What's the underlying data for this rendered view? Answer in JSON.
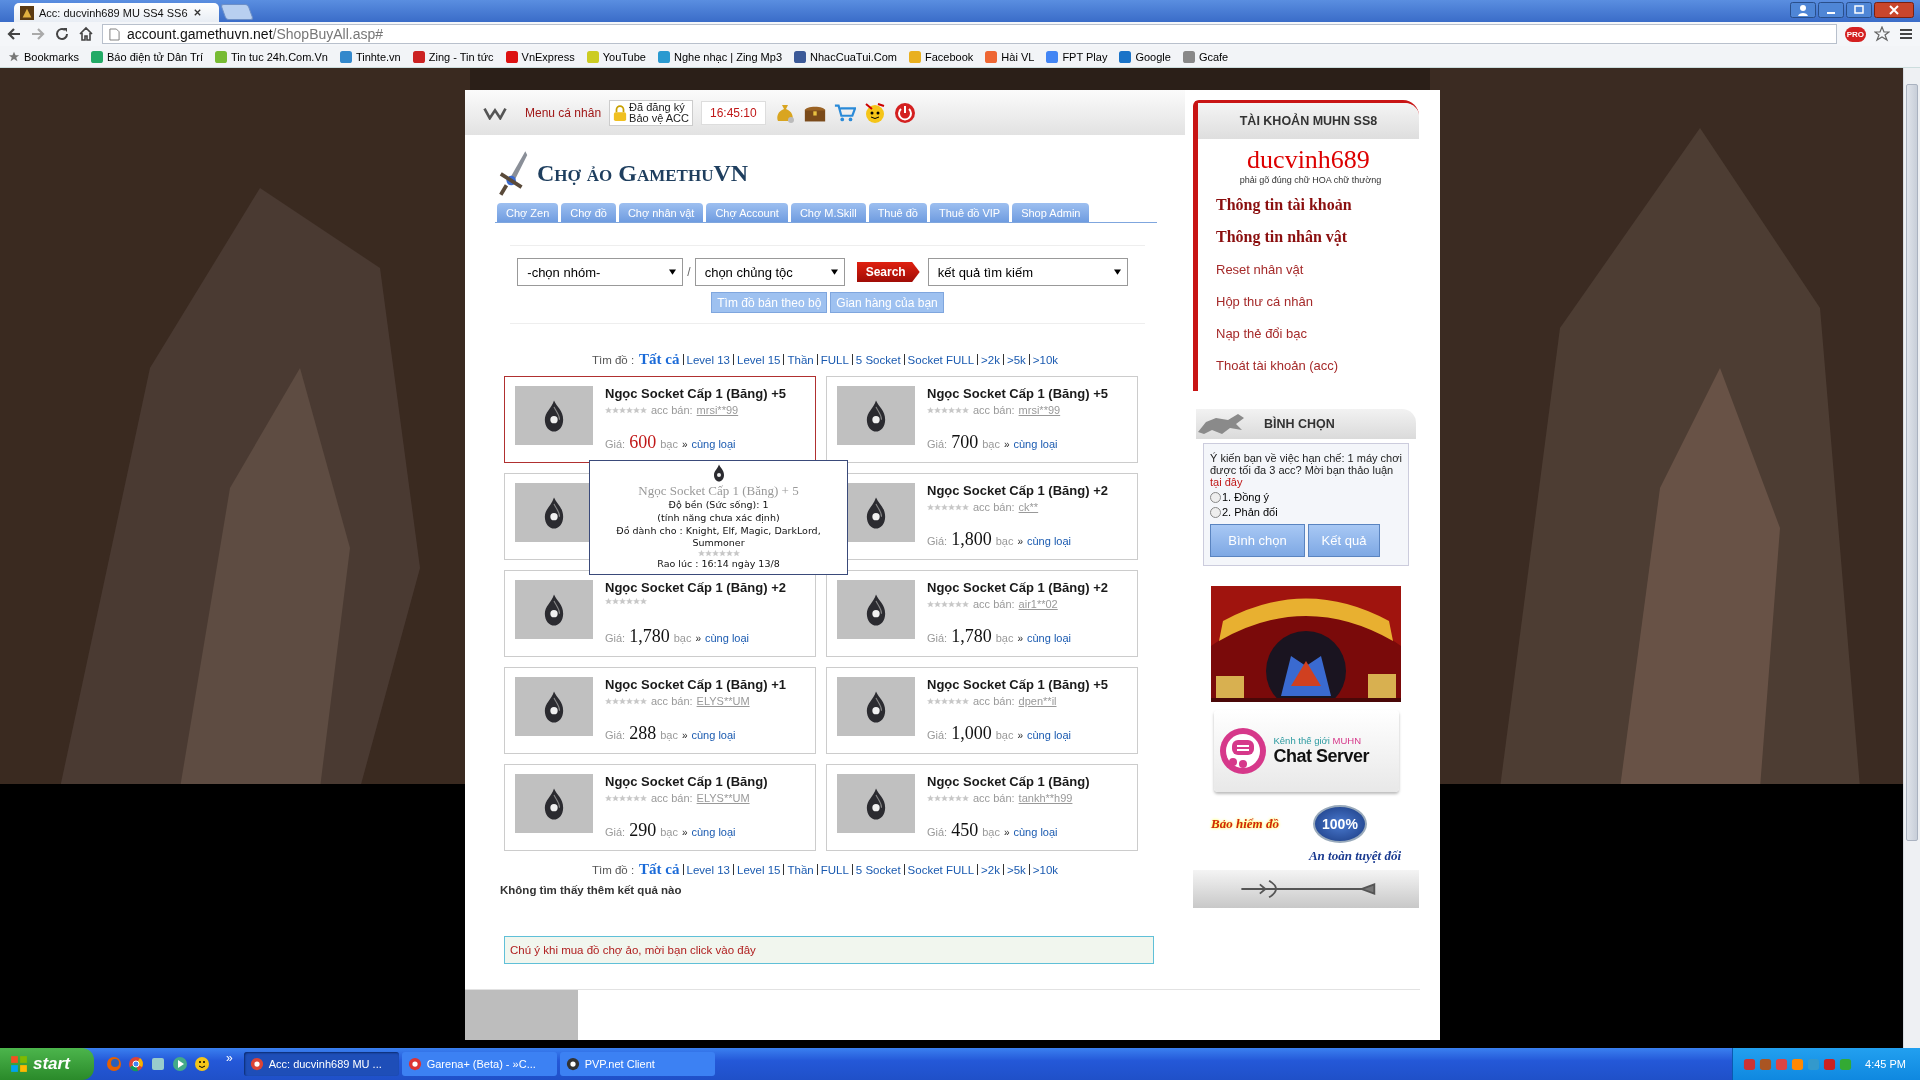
{
  "browser": {
    "tab_title": "Acc: ducvinh689 MU SS4 SS6",
    "address": {
      "host": "account.gamethuvn.net",
      "path": "/ShopBuyAll.asp#"
    },
    "extension_badge": "PRO",
    "bookmarks": [
      "Bookmarks",
      "Báo điện tử Dân Trí",
      "Tin tuc 24h.Com.Vn",
      "Tinhte.vn",
      "Zing - Tin tức",
      "VnExpress",
      "YouTube",
      "Nghe nhạc | Zing Mp3",
      "NhacCuaTui.Com",
      "Facebook",
      "Hài VL",
      "FPT Play",
      "Google",
      "Gcafe"
    ]
  },
  "topbar": {
    "menu": "Menu cá nhân",
    "protection": {
      "line1": "Đã đăng ký",
      "line2": "Bảo vệ ACC"
    },
    "clock": "16:45:10"
  },
  "title": "Chợ ảo GamethuVN",
  "tabs": [
    {
      "label": "Chợ Zen",
      "selected": false
    },
    {
      "label": "Chợ đồ",
      "selected": false
    },
    {
      "label": "Chợ nhân vật",
      "selected": false
    },
    {
      "label": "Chợ Account",
      "selected": false
    },
    {
      "label": "Chợ M.Skill",
      "selected": false
    },
    {
      "label": "Thuê đồ",
      "selected": false
    },
    {
      "label": "Thuê đồ VIP",
      "selected": false
    },
    {
      "label": "Shop Admin",
      "selected": false
    }
  ],
  "search": {
    "group": "-chọn nhóm-",
    "separator": "/",
    "race": "chọn chủng tộc",
    "button": "Search",
    "results": "kết quả tìm kiếm",
    "actions": [
      "Tìm đồ bán theo bộ",
      "Gian hàng của bạn"
    ]
  },
  "filters_top": {
    "label": "Tìm đồ :",
    "links": [
      {
        "text": "Tất cả",
        "selected": true
      },
      {
        "text": "Level 13",
        "selected": false
      },
      {
        "text": "Level 15",
        "selected": false
      },
      {
        "text": "Thần",
        "selected": false
      },
      {
        "text": "FULL",
        "selected": false
      },
      {
        "text": "5 Socket",
        "selected": false
      },
      {
        "text": "Socket FULL",
        "selected": false
      },
      {
        "text": ">2k",
        "selected": false
      },
      {
        "text": ">5k",
        "selected": false
      },
      {
        "text": ">10k",
        "selected": false
      }
    ]
  },
  "items": [
    {
      "title": "Ngọc Socket Cấp 1 (Băng) +5",
      "stars": 0,
      "seller_label": "acc bán:",
      "seller": "mrsi**99",
      "price_label": "Giá:",
      "price": "600",
      "unit": "bạc",
      "arrow": "»",
      "link": "cùng loại",
      "hovered": true
    },
    {
      "title": "Ngọc Socket Cấp 1 (Băng) +5",
      "stars": 0,
      "seller_label": "acc bán:",
      "seller": "mrsi**99",
      "price_label": "Giá:",
      "price": "700",
      "unit": "bạc",
      "arrow": "»",
      "link": "cùng loại",
      "hovered": false
    },
    {
      "hovered": false
    },
    {
      "title": "Ngọc Socket Cấp 1 (Băng) +2",
      "stars": 0,
      "seller_label": "acc bán:",
      "seller": "ck**",
      "price_label": "Giá:",
      "price": "1,800",
      "unit": "bạc",
      "arrow": "»",
      "link": "cùng loại",
      "hovered": false
    },
    {
      "title": "Ngọc Socket Cấp 1 (Băng) +2",
      "stars": 0,
      "price_label": "Giá:",
      "price": "1,780",
      "unit": "bạc",
      "arrow": "»",
      "link": "cùng loại",
      "hovered": false
    },
    {
      "title": "Ngọc Socket Cấp 1 (Băng) +2",
      "stars": 0,
      "seller_label": "acc bán:",
      "seller": "air1**02",
      "price_label": "Giá:",
      "price": "1,780",
      "unit": "bạc",
      "arrow": "»",
      "link": "cùng loại",
      "hovered": false
    },
    {
      "title": "Ngọc Socket Cấp 1 (Băng) +1",
      "stars": 0,
      "seller_label": "acc bán:",
      "seller": "ELYS**UM",
      "price_label": "Giá:",
      "price": "288",
      "unit": "bạc",
      "arrow": "»",
      "link": "cùng loại",
      "hovered": false
    },
    {
      "title": "Ngọc Socket Cấp 1 (Băng) +5",
      "stars": 0,
      "seller_label": "acc bán:",
      "seller": "dpen**il",
      "price_label": "Giá:",
      "price": "1,000",
      "unit": "bạc",
      "arrow": "»",
      "link": "cùng loại",
      "hovered": false
    },
    {
      "title": "Ngọc Socket Cấp 1 (Băng)",
      "stars": 0,
      "seller_label": "acc bán:",
      "seller": "ELYS**UM",
      "price_label": "Giá:",
      "price": "290",
      "unit": "bạc",
      "arrow": "»",
      "link": "cùng loại",
      "hovered": false
    },
    {
      "title": "Ngọc Socket Cấp 1 (Băng)",
      "stars": 0,
      "seller_label": "acc bán:",
      "seller": "tankh**h99",
      "price_label": "Giá:",
      "price": "450",
      "unit": "bạc",
      "arrow": "»",
      "link": "cùng loại",
      "hovered": false
    }
  ],
  "tooltip": {
    "title": "Ngọc Socket Cấp 1 (Băng) + 5",
    "lines": [
      "Độ bền (Sức sống): 1",
      "(tính năng chưa xác định)",
      "Đồ dành cho : Knight, Elf, Magic, DarkLord, Summoner"
    ],
    "stars": 0,
    "posted": "Rao lúc : 16:14 ngày 13/8"
  },
  "filters_bottom": {
    "label": "Tìm đồ :",
    "links": [
      {
        "text": "Tất cả",
        "selected": true
      },
      {
        "text": "Level 13",
        "selected": false
      },
      {
        "text": "Level 15",
        "selected": false
      },
      {
        "text": "Thần",
        "selected": false
      },
      {
        "text": "FULL",
        "selected": false
      },
      {
        "text": "5 Socket",
        "selected": false
      },
      {
        "text": "Socket FULL",
        "selected": false
      },
      {
        "text": ">2k",
        "selected": false
      },
      {
        "text": ">5k",
        "selected": false
      },
      {
        "text": ">10k",
        "selected": false
      }
    ]
  },
  "no_more": "Không tìm thấy thêm kết quả nào",
  "notice": "Chú ý khi mua đồ chợ ảo, mời bạn click vào đây",
  "sidebar": {
    "account": {
      "header": "TÀI KHOẢN MUHN SS8",
      "username": "ducvinh689",
      "hint": "phải gõ đúng chữ HOA chữ thường",
      "links": [
        {
          "text": "Thông tin tài khoản",
          "kind": "major"
        },
        {
          "text": "Thông tin nhân vật",
          "kind": "major"
        },
        {
          "text": "Reset nhân vật",
          "kind": "minor"
        },
        {
          "text": "Hộp thư cá nhân",
          "kind": "minor"
        },
        {
          "text": "Nạp thẻ đổi bạc",
          "kind": "minor"
        },
        {
          "text": "Thoát tài khoản (acc)",
          "kind": "minor"
        }
      ]
    },
    "poll": {
      "header": "BÌNH CHỌN",
      "question": "Ý kiến bạn về việc hạn chế: 1 máy chơi được tối đa 3 acc? Mời bạn thảo luận",
      "link": "tại đây",
      "options": [
        {
          "label": "1. Đồng ý",
          "selected": false
        },
        {
          "label": "2. Phản đối",
          "selected": false
        }
      ],
      "buttons": [
        "Bình chọn",
        "Kết quả"
      ]
    },
    "banners": [
      {
        "kind": "picture"
      },
      {
        "kind": "chat",
        "caption": "Kênh thế giới",
        "highlight": "MUHN",
        "title": "Chat Server"
      },
      {
        "kind": "insurance",
        "line1": "Bảo hiểm đồ",
        "badge": "100%",
        "line2": "An toàn tuyệt đối"
      }
    ]
  },
  "taskbar": {
    "start": "start",
    "more": "»",
    "tasks": [
      {
        "label": "Acc: ducvinh689 MU ...",
        "selected": true
      },
      {
        "label": "Garena+ (Beta) - »C...",
        "selected": false
      },
      {
        "label": "PVP.net Client",
        "selected": false
      }
    ],
    "time": "4:45 PM"
  }
}
